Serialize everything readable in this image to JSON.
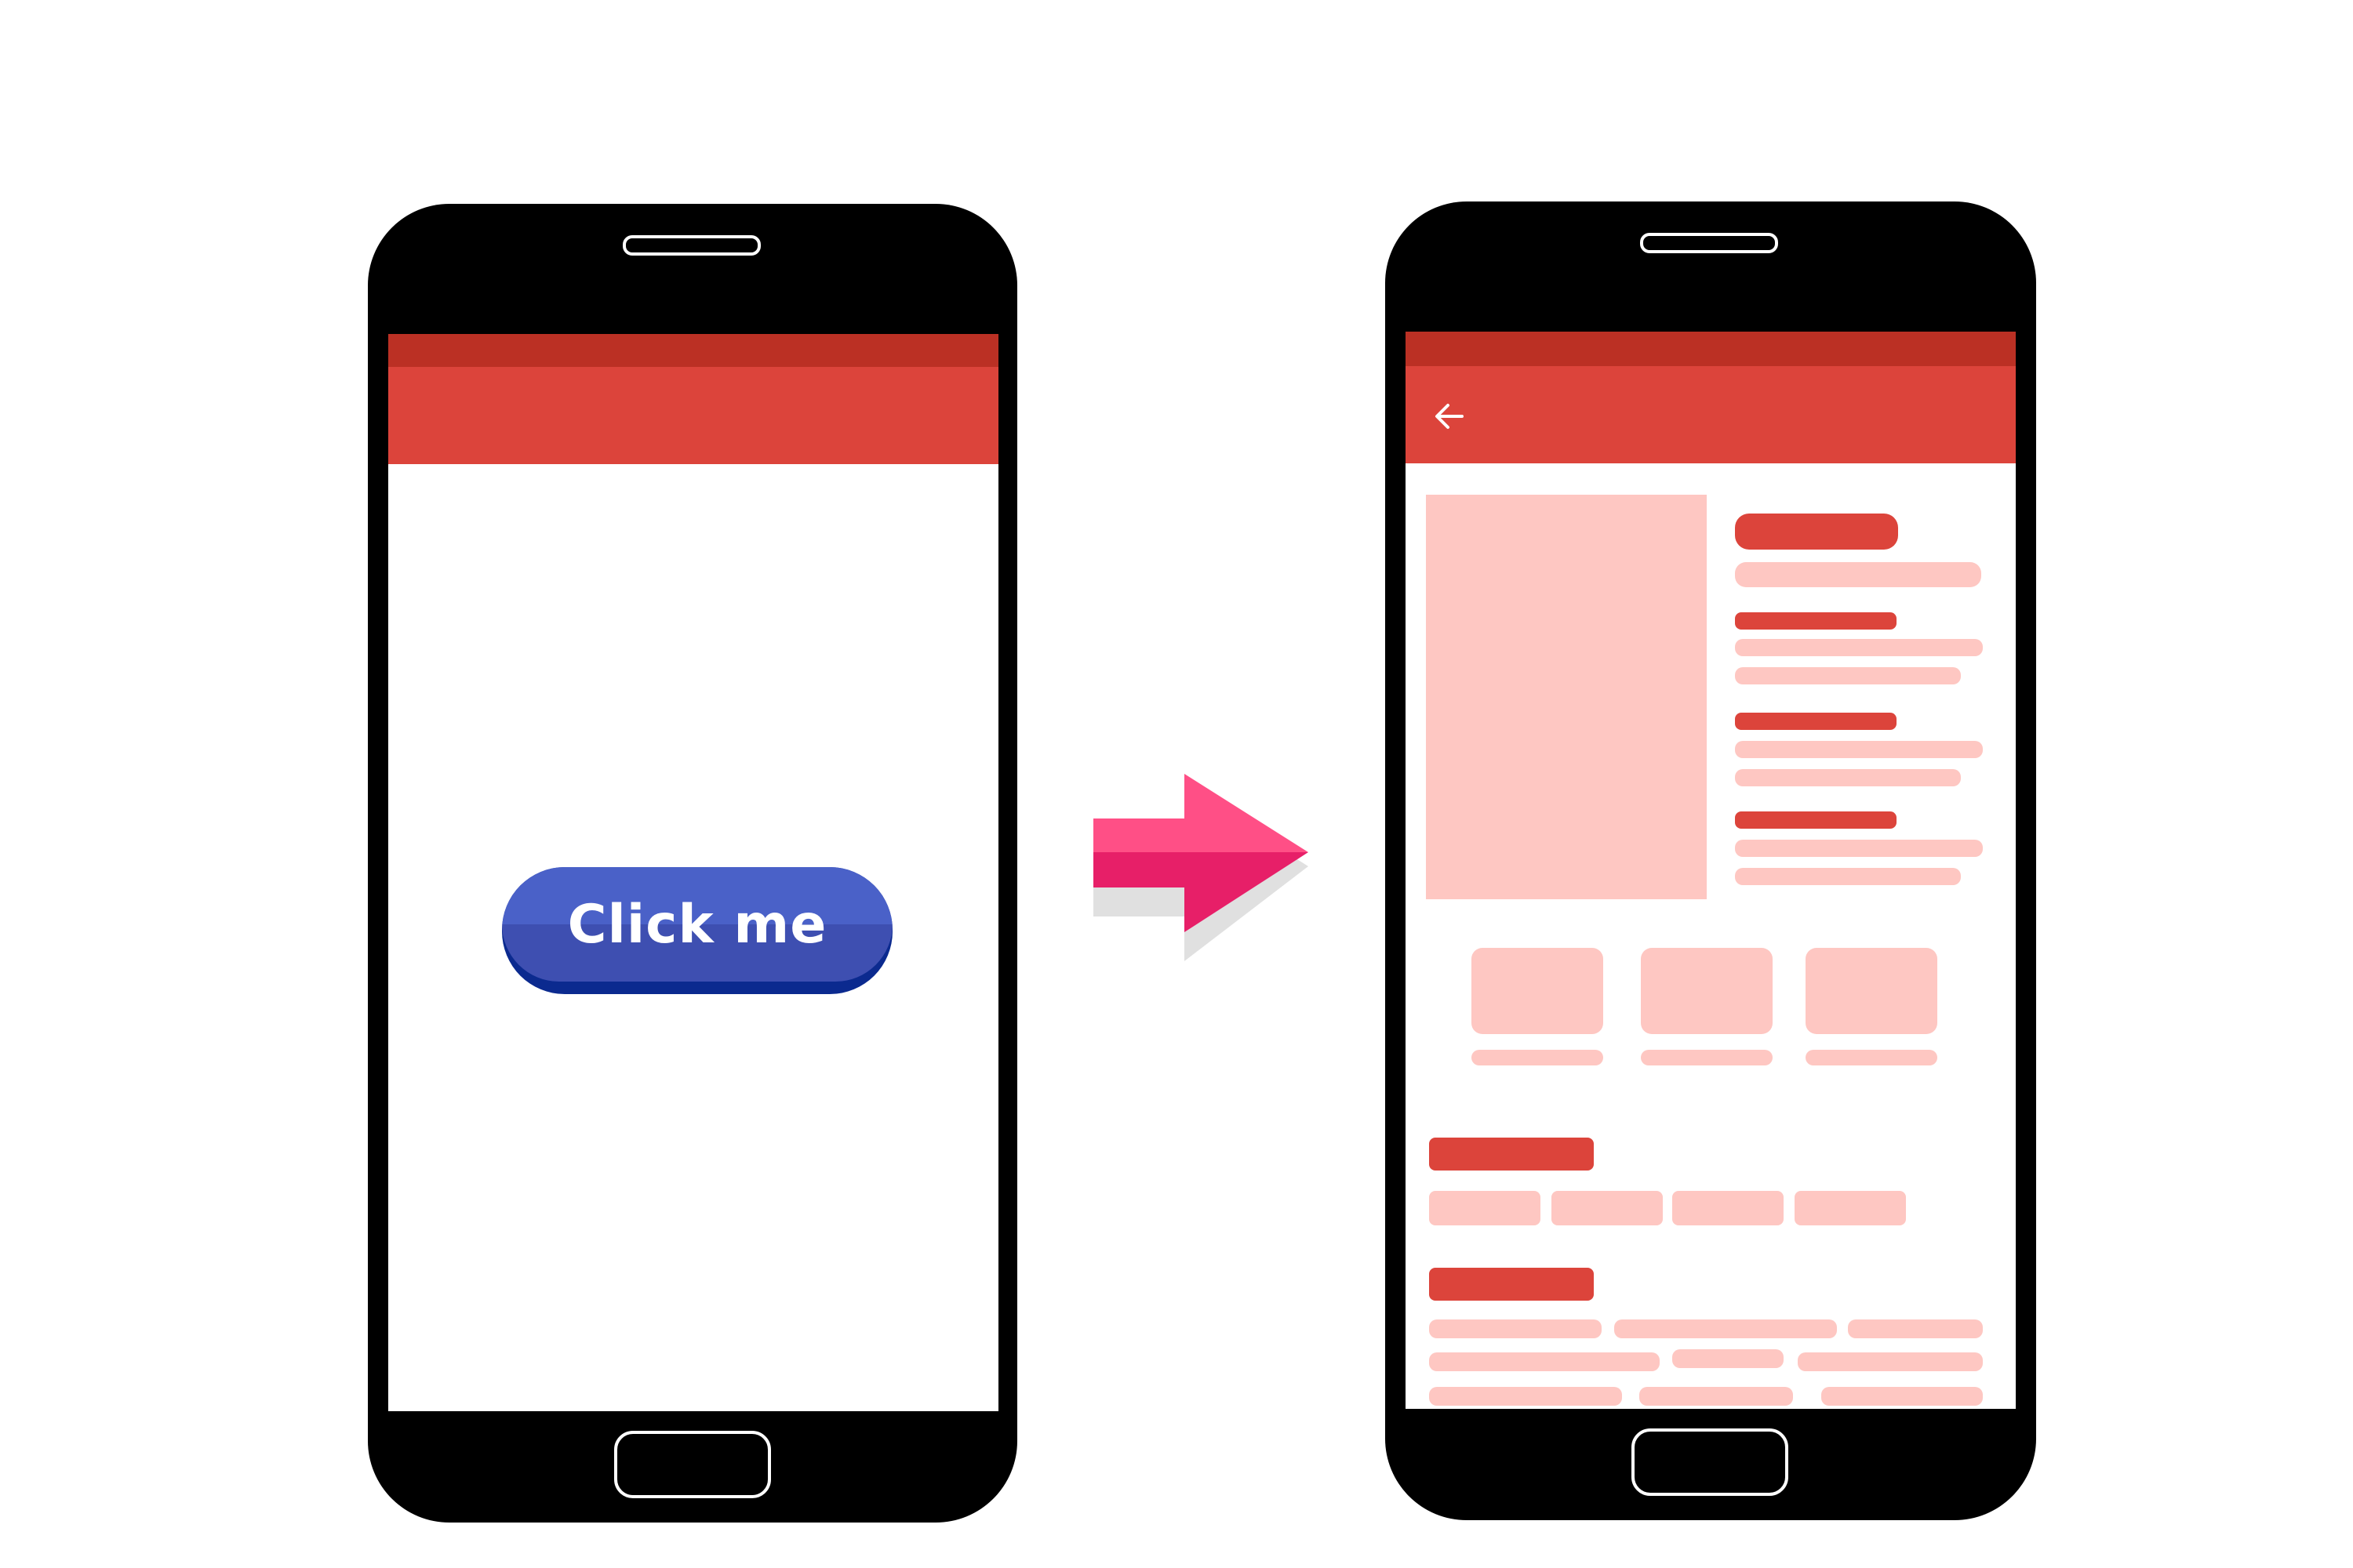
{
  "colors": {
    "phone_body": "#000000",
    "status_bar": "#bb3024",
    "app_bar": "#dc443b",
    "placeholder_dark": "#dc443b",
    "placeholder_light": "#fec7c2",
    "button_top": "#4a61c8",
    "button_bottom": "#3e4fb1",
    "button_edge": "#0b2a8f",
    "arrow_top": "#ff4f86",
    "arrow_bottom": "#e71f68",
    "arrow_shadow": "#e0e0e0"
  },
  "left_phone": {
    "button_label": "Click me"
  },
  "arrow": {
    "icon": "arrow-right-icon"
  },
  "right_phone": {
    "app_bar": {
      "icon": "back-arrow-icon"
    },
    "sections": [
      "hero-image",
      "detail-lines",
      "thumbnail-row",
      "chip-group",
      "text-block"
    ]
  }
}
